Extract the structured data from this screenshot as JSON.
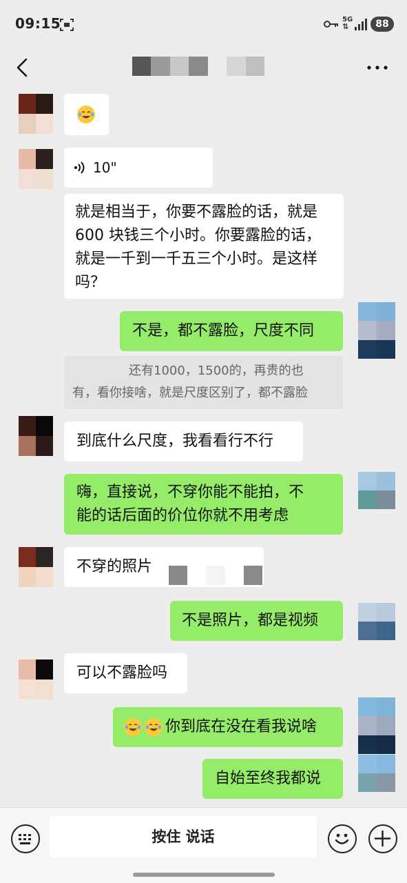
{
  "status_bar": {
    "time": "09:15",
    "network": "5G",
    "battery": "88",
    "icons": [
      "screen-record-icon",
      "key-icon",
      "5g-data-icon",
      "signal-icon",
      "battery-icon"
    ]
  },
  "nav": {
    "back_icon": "chevron-left-icon",
    "more_icon": "more-dots-icon"
  },
  "messages": [
    {
      "side": "in",
      "kind": "emoji",
      "emoji": "laughing-crying-face"
    },
    {
      "side": "in",
      "kind": "voice",
      "duration": "10\""
    },
    {
      "side": "in",
      "kind": "text",
      "lines": [
        "就是相当于，你要不露脸的话，就是",
        "600 块钱三个小时。你要露脸的话，",
        "就是一千到一千五三个小时。是这样",
        "吗？"
      ]
    },
    {
      "side": "out",
      "kind": "text",
      "lines": [
        "不是，都不露脸，尺度不同"
      ]
    },
    {
      "side": "quote",
      "kind": "quote",
      "lines": [
        "还有1000，1500的，再贵的也",
        "有，看你接啥，就是尺度区别了，都不露脸"
      ]
    },
    {
      "side": "in",
      "kind": "text",
      "lines": [
        "到底什么尺度，我看看行不行"
      ]
    },
    {
      "side": "out",
      "kind": "text",
      "lines": [
        "嗨，直接说，不穿你能不能拍，不",
        "能的话后面的价位你就不用考虑"
      ]
    },
    {
      "side": "in",
      "kind": "text",
      "lines": [
        "不穿的照片"
      ]
    },
    {
      "side": "out",
      "kind": "text",
      "lines": [
        "不是照片，都是视频"
      ]
    },
    {
      "side": "in",
      "kind": "text",
      "lines": [
        "可以不露脸吗"
      ]
    },
    {
      "side": "out",
      "kind": "text",
      "lines": [
        "你到底在没在看我说啥"
      ],
      "emoji_prefix": [
        "laughing-crying-face",
        "laughing-crying-face"
      ]
    },
    {
      "side": "out",
      "kind": "text",
      "lines": [
        "自始至终我都说"
      ]
    }
  ],
  "input_bar": {
    "hold_to_talk": "按住 说话",
    "keyboard_icon": "keyboard-icon",
    "emoji_icon": "smiley-icon",
    "plus_icon": "plus-icon"
  },
  "colors": {
    "background": "#ededed",
    "incoming_bubble": "#ffffff",
    "outgoing_bubble": "#95ec69",
    "quote_bg": "#e3e3e3"
  }
}
